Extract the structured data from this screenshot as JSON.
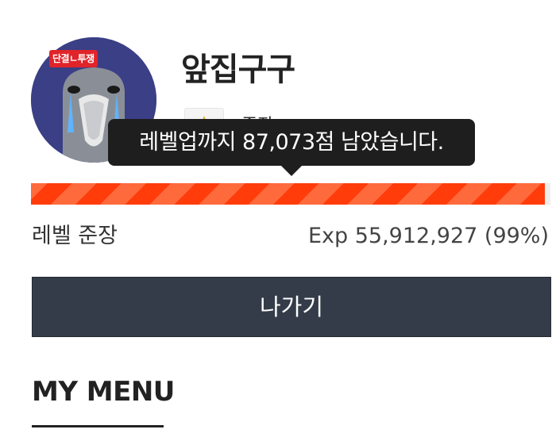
{
  "profile": {
    "nickname": "앞집구구",
    "avatar_badge": "단결ㄴ투쟁",
    "level_name": "준장",
    "level_icon": "rank-insignia-icon"
  },
  "tooltip": {
    "text": "레벨업까지 87,073점 남았습니다."
  },
  "progress": {
    "percent": 99,
    "level_label": "레벨 준장",
    "exp_label": "Exp 55,912,927 (99%)",
    "colors": {
      "fill": "#ff3c0a",
      "stripe": "#ff6a3d"
    }
  },
  "actions": {
    "exit_label": "나가기"
  },
  "menu": {
    "title": "MY MENU"
  },
  "colors": {
    "button_bg": "#333c48",
    "tooltip_bg": "#1e1e1e",
    "avatar_bg": "#3a3f86"
  }
}
